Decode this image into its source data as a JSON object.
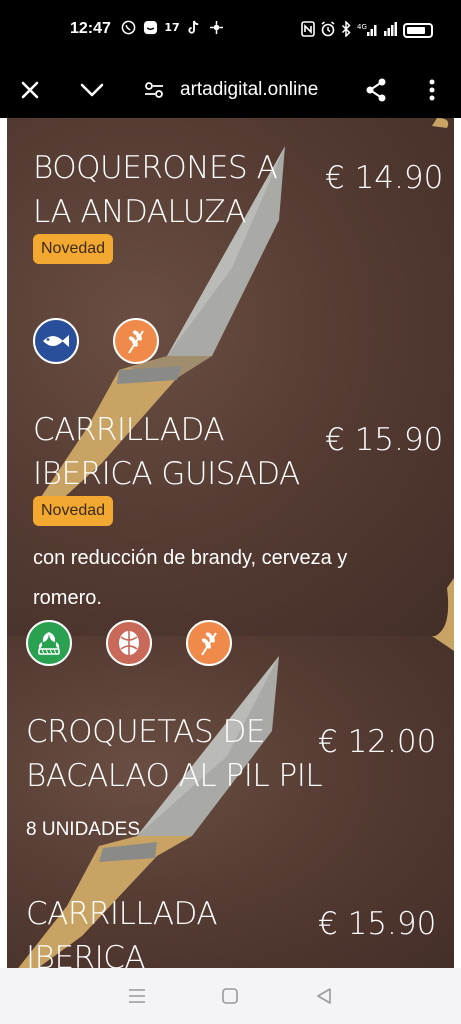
{
  "status_bar": {
    "time": "12:47",
    "notification_icons": [
      "whatsapp-icon",
      "messenger-icon",
      "tv-app-icon",
      "tiktok-icon",
      "app-icon"
    ],
    "system_icons": [
      "nfc-icon",
      "alarm-icon",
      "bluetooth-icon",
      "4g-signal-icon",
      "signal-icon",
      "battery-icon"
    ]
  },
  "toolbar": {
    "url": "artadigital.online"
  },
  "menu_items": [
    {
      "name": "BOQUERONES A LA ANDALUZA",
      "price": "€  14.90",
      "badge": "Novedad",
      "description": "",
      "icons": [
        "fish-icon",
        "gluten-icon"
      ]
    },
    {
      "name": "CARRILLADA IBERICA GUISADA",
      "price": "€  15.90",
      "badge": "Novedad",
      "description": "con reducción de brandy, cerveza y romero.",
      "icons": [
        "celery-icon",
        "nuts-icon",
        "gluten-icon"
      ]
    },
    {
      "name": "CROQUETAS DE BACALAO AL PIL PIL",
      "price": "€  12.00",
      "badge": "",
      "description": "8 UNIDADES",
      "icons": []
    },
    {
      "name": "CARRILLADA IBERICA",
      "price": "€  15.90",
      "badge": "",
      "description": "",
      "icons": []
    }
  ],
  "colors": {
    "badge": "#f2a831",
    "fish_icon_bg": "#2a4f9a",
    "gluten_icon_bg": "#f08a4b",
    "celery_icon_bg": "#2aa150",
    "nuts_icon_bg": "#c8695a",
    "panel_bg": "#563c33"
  }
}
